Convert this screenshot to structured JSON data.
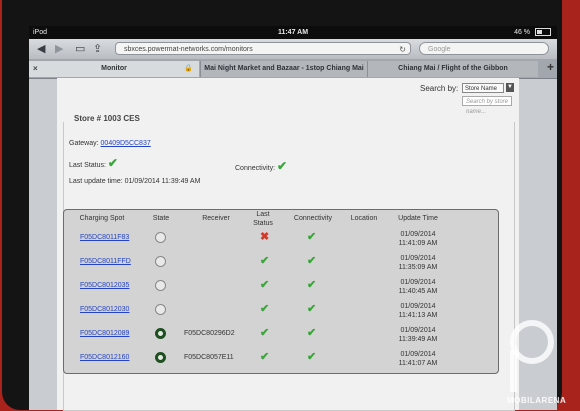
{
  "status_bar": {
    "carrier": "iPod",
    "time": "11:47 AM",
    "battery": "46 %"
  },
  "browser": {
    "url": "sbxces.powermat-networks.com/monitors",
    "search_placeholder": "Google",
    "tabs": [
      {
        "label": "Monitor"
      },
      {
        "label": "Mai Night Market and Bazaar - 1stop Chiang Mai"
      },
      {
        "label": "Chiang Mai / Flight of the Gibbon"
      }
    ],
    "new_tab": "+"
  },
  "page": {
    "search_by_label": "Search by:",
    "search_by_value": "Store Name",
    "search_placeholder": "Search by store name...",
    "store_title": "Store # 1003 CES",
    "gateway_label": "Gateway:",
    "gateway_value": "00409D5CC837",
    "last_status_label": "Last Status:",
    "connectivity_label": "Connectivity:",
    "last_update_label": "Last update time: 01/09/2014 11:39:49 AM"
  },
  "table": {
    "headers": {
      "spot": "Charging Spot",
      "state": "State",
      "receiver": "Receiver",
      "last_status": "Last Status",
      "connectivity": "Connectivity",
      "location": "Location",
      "update_time": "Update Time"
    },
    "rows": [
      {
        "spot": "F05DC8011F83",
        "state": "off",
        "receiver": "",
        "last_status": "fail",
        "connectivity": "ok",
        "date": "01/09/2014",
        "time": "11:41:09 AM"
      },
      {
        "spot": "F05DC8011FFD",
        "state": "off",
        "receiver": "",
        "last_status": "ok",
        "connectivity": "ok",
        "date": "01/09/2014",
        "time": "11:35:09 AM"
      },
      {
        "spot": "F05DC8012035",
        "state": "off",
        "receiver": "",
        "last_status": "ok",
        "connectivity": "ok",
        "date": "01/09/2014",
        "time": "11:40:45 AM"
      },
      {
        "spot": "F05DC8012030",
        "state": "off",
        "receiver": "",
        "last_status": "ok",
        "connectivity": "ok",
        "date": "01/09/2014",
        "time": "11:41:13 AM"
      },
      {
        "spot": "F05DC8012089",
        "state": "on",
        "receiver": "F05DC80296D2",
        "last_status": "ok",
        "connectivity": "ok",
        "date": "01/09/2014",
        "time": "11:39:49 AM"
      },
      {
        "spot": "F05DC8012160",
        "state": "on",
        "receiver": "F05DC8057E11",
        "last_status": "ok",
        "connectivity": "ok",
        "date": "01/09/2014",
        "time": "11:41:07 AM"
      }
    ]
  },
  "watermark": "MOBILARENA",
  "colors": {
    "link": "#2544c4",
    "check": "#3aa53a",
    "cross": "#d23a2a",
    "state_on": "#1f4f20"
  }
}
